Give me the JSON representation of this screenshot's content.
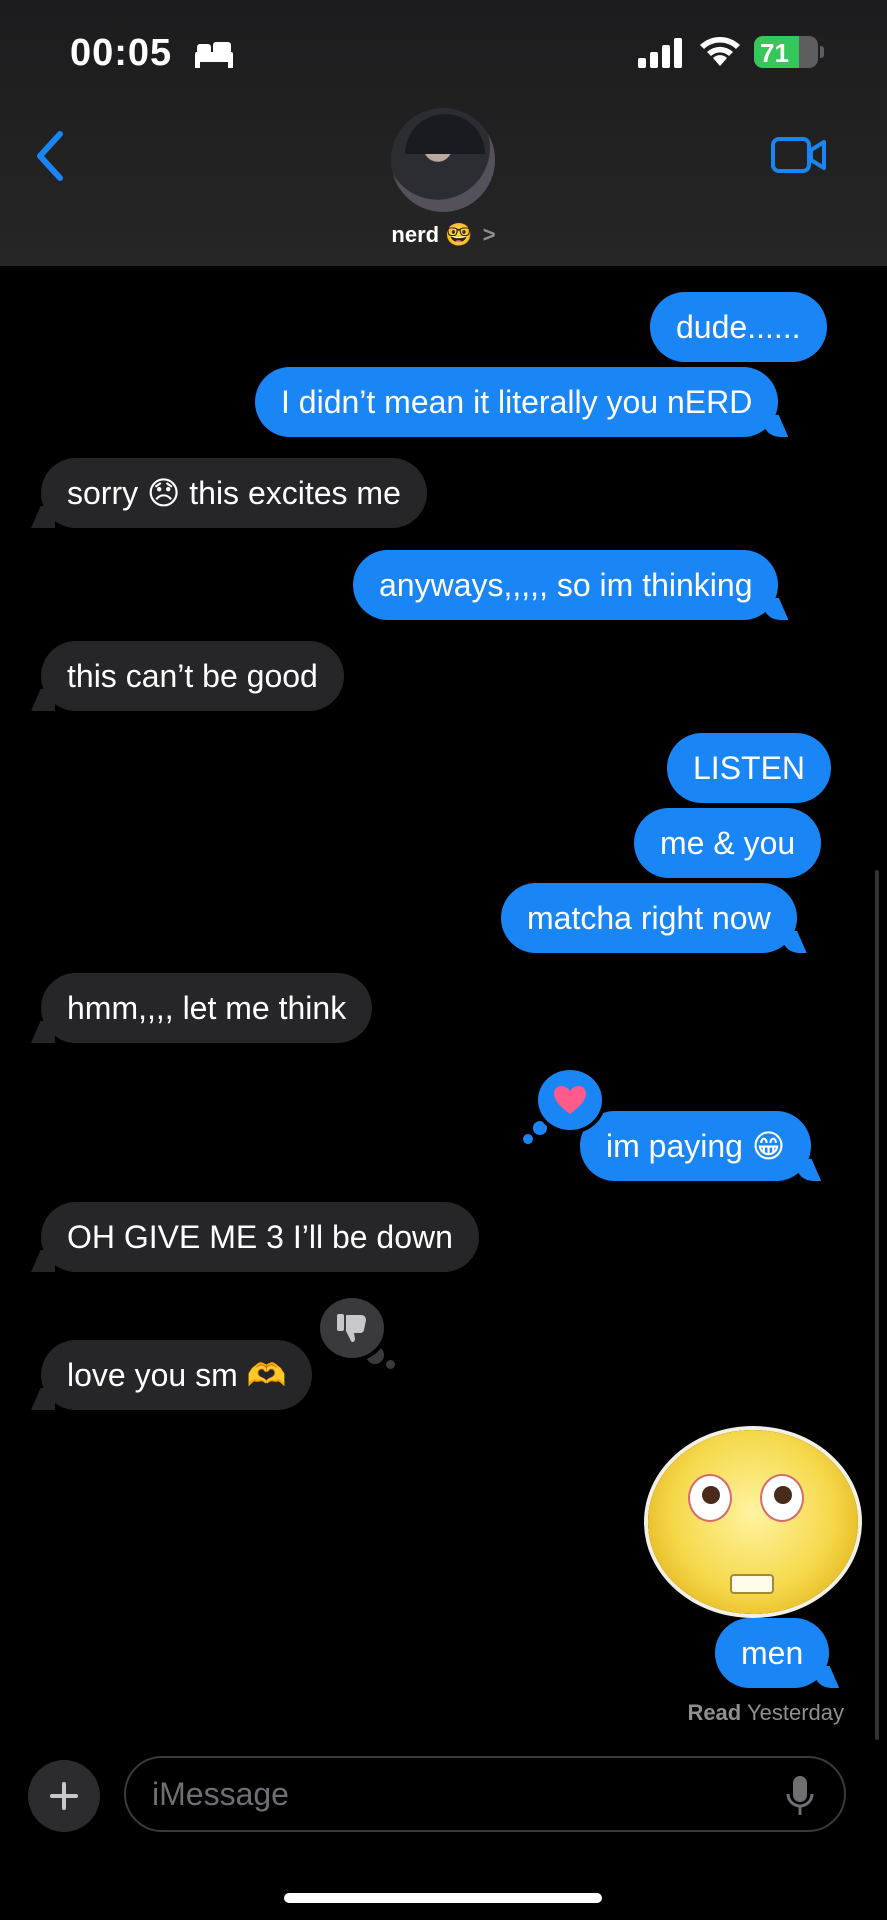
{
  "status_bar": {
    "time": "00:05",
    "battery_level": "71",
    "battery_fraction": 0.71
  },
  "header": {
    "contact_name": "nerd",
    "contact_emoji": "🤓",
    "chevron": ">"
  },
  "messages": [
    {
      "side": "sent",
      "text": "dude......"
    },
    {
      "side": "sent",
      "text": "I didn’t mean it literally you nERD"
    },
    {
      "side": "received",
      "text": "sorry 😞 this excites me"
    },
    {
      "side": "sent",
      "text": "anyways,,,,, so im thinking"
    },
    {
      "side": "received",
      "text": "this can’t be good"
    },
    {
      "side": "sent",
      "text": "LISTEN"
    },
    {
      "side": "sent",
      "text": "me & you"
    },
    {
      "side": "sent",
      "text": "matcha right now"
    },
    {
      "side": "received",
      "text": "hmm,,,, let me think"
    },
    {
      "side": "sent",
      "text": "im paying 😁",
      "tapback": "heart"
    },
    {
      "side": "received",
      "text": "OH GIVE ME 3 I’ll be down"
    },
    {
      "side": "received",
      "text": "love you sm 🫶",
      "tapback": "thumbs-down"
    },
    {
      "side": "sent",
      "sticker": "emoji-face-sticker"
    },
    {
      "side": "sent",
      "text": "men"
    }
  ],
  "read_receipt": {
    "label": "Read",
    "time": "Yesterday"
  },
  "composer": {
    "placeholder": "iMessage"
  },
  "colors": {
    "sent_bubble": "#1a86f5",
    "received_bubble": "#262628",
    "accent": "#1a86f5",
    "battery": "#34c759"
  }
}
